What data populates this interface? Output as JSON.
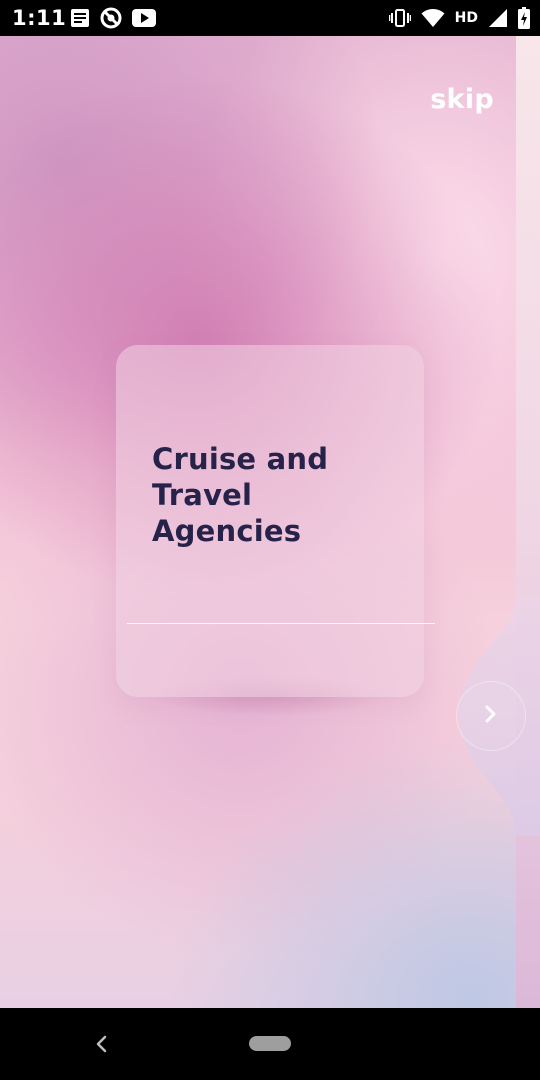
{
  "status_bar": {
    "time": "1:11",
    "left_icons": [
      "news-icon",
      "vpn-icon",
      "youtube-icon"
    ],
    "right_icons": [
      "vibrate-icon",
      "wifi-icon",
      "signal-icon",
      "battery-icon"
    ],
    "network_label": "HD"
  },
  "onboarding": {
    "skip_label": "skip",
    "card_title": "Cruise and Travel Agencies",
    "next_icon": "chevron-right-icon"
  },
  "navigation_bar": {
    "icons": [
      "back-icon",
      "home-pill-icon"
    ]
  },
  "colors": {
    "title_text": "#26224a",
    "skip_text": "#ffffff",
    "background_pink": "#eeb6d2",
    "background_lavender": "#bec8e4"
  }
}
